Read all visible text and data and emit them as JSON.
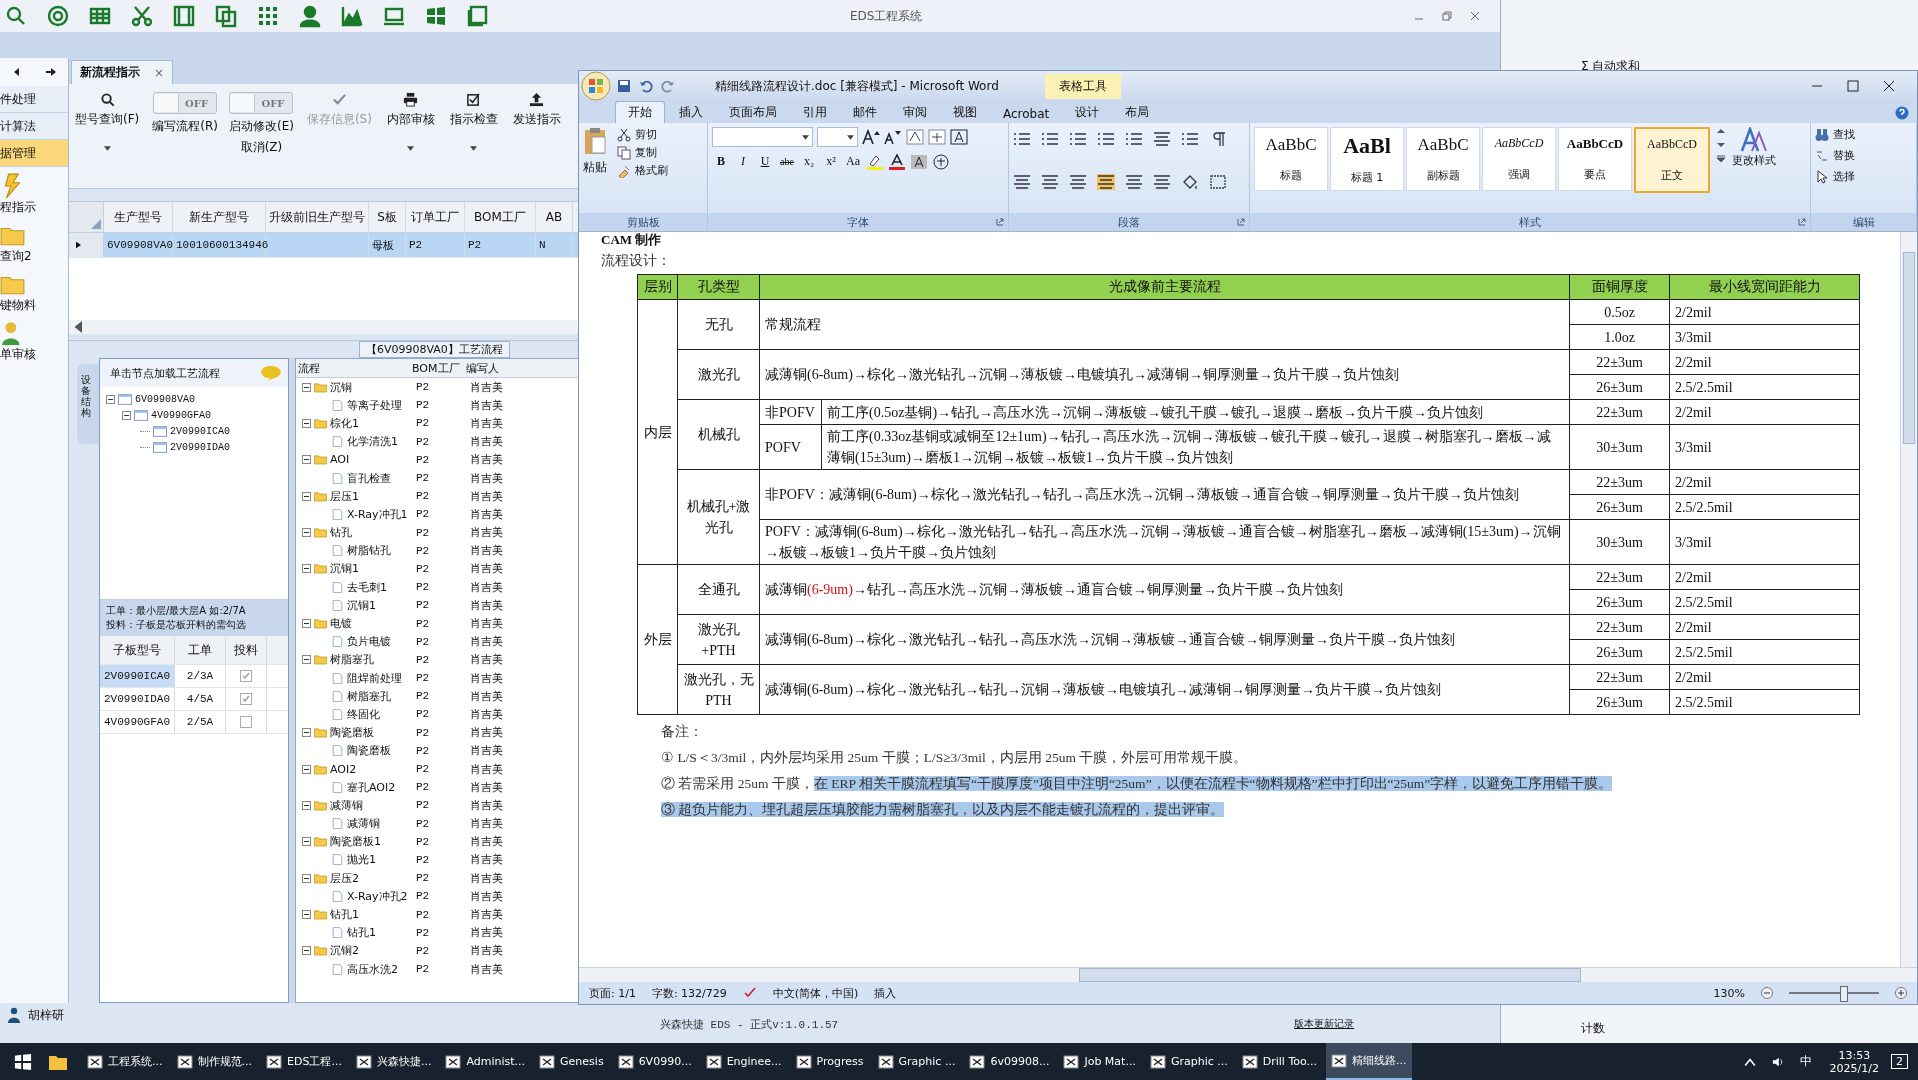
{
  "eds": {
    "title": "EDS工程系统",
    "nav": [
      {
        "label": "件处理",
        "selected": false
      },
      {
        "label": "计算法",
        "selected": false
      },
      {
        "label": "据管理",
        "selected": true
      }
    ],
    "nav_tools": [
      {
        "label": "程指示"
      },
      {
        "label": "查询2"
      },
      {
        "label": "键物料"
      },
      {
        "label": "单审核"
      }
    ],
    "tab": {
      "label": "新流程指示",
      "close": "×"
    },
    "toolbar": [
      {
        "kind": "button",
        "label": "型号查询(F)",
        "dropdown": true,
        "disabled": false
      },
      {
        "kind": "toggle",
        "label": "编写流程(R)",
        "state_label": "OFF",
        "on": false
      },
      {
        "kind": "toggle",
        "label": "启动修改(E)",
        "label2": "取消(Z)",
        "state_label": "OFF",
        "on": false
      },
      {
        "kind": "button",
        "label": "保存信息(S)",
        "dropdown": false,
        "disabled": true
      },
      {
        "kind": "button",
        "label": "内部审核",
        "dropdown": true,
        "disabled": false
      },
      {
        "kind": "button",
        "label": "指示检查",
        "dropdown": true,
        "disabled": false
      },
      {
        "kind": "button",
        "label": "发送指示",
        "dropdown": false,
        "disabled": false
      }
    ],
    "grid": {
      "columns": [
        "生产型号",
        "新生产型号",
        "升级前旧生产型号",
        "S板",
        "订单工厂",
        "BOM工厂",
        "AB"
      ],
      "rows": [
        {
          "selected": true,
          "cells": [
            "6V09908VA0",
            "10010600134946",
            null,
            "母板",
            "P2",
            "P2",
            "N"
          ]
        }
      ]
    },
    "process_title": "【6V09908VA0】工艺流程",
    "side_tab": "设备结构",
    "tree_hint": "单击节点加载工艺流程",
    "tree": [
      {
        "label": "6V09908VA0",
        "expanded": true,
        "children": [
          {
            "label": "4V0990GFA0",
            "expanded": true,
            "children": [
              {
                "label": "2V0990ICA0"
              },
              {
                "label": "2V0990IDA0"
              }
            ]
          }
        ]
      }
    ],
    "notes": [
      "工单：最小层/最大层A 如:2/7A",
      "投料：子板是芯板开料的需勾选"
    ],
    "sub_table": {
      "columns": [
        "子板型号",
        "工单",
        "投料"
      ],
      "rows": [
        {
          "model": "2V0990ICA0",
          "order": "2/3A",
          "feed": true,
          "selected": true
        },
        {
          "model": "2V0990IDA0",
          "order": "4/5A",
          "feed": true,
          "selected": false
        },
        {
          "model": "4V0990GFA0",
          "order": "2/5A",
          "feed": false,
          "selected": false
        }
      ]
    },
    "flow": {
      "columns": [
        "流程",
        "BOM工厂",
        "编写人"
      ],
      "groups": [
        {
          "name": "沉铜",
          "bom": "P2",
          "author": "肖吉美",
          "expanded": true,
          "children": [
            {
              "name": "等离子处理",
              "bom": "P2",
              "author": "肖吉美"
            }
          ]
        },
        {
          "name": "棕化1",
          "bom": "P2",
          "author": "肖吉美",
          "expanded": true,
          "children": [
            {
              "name": "化学清洗1",
              "bom": "P2",
              "author": "肖吉美"
            }
          ]
        },
        {
          "name": "AOI",
          "bom": "P2",
          "author": "肖吉美",
          "expanded": true,
          "children": [
            {
              "name": "盲孔检查",
              "bom": "P2",
              "author": "肖吉美"
            }
          ]
        },
        {
          "name": "层压1",
          "bom": "P2",
          "author": "肖吉美",
          "expanded": true,
          "children": [
            {
              "name": "X-Ray冲孔1",
              "bom": "P2",
              "author": "肖吉美"
            }
          ]
        },
        {
          "name": "钻孔",
          "bom": "P2",
          "author": "肖吉美",
          "expanded": true,
          "children": [
            {
              "name": "树脂钻孔",
              "bom": "P2",
              "author": "肖吉美"
            }
          ]
        },
        {
          "name": "沉铜1",
          "bom": "P2",
          "author": "肖吉美",
          "expanded": true,
          "children": [
            {
              "name": "去毛刺1",
              "bom": "P2",
              "author": "肖吉美"
            },
            {
              "name": "沉铜1",
              "bom": "P2",
              "author": "肖吉美"
            }
          ]
        },
        {
          "name": "电镀",
          "bom": "P2",
          "author": "肖吉美",
          "expanded": true,
          "children": [
            {
              "name": "负片电镀",
              "bom": "P2",
              "author": "肖吉美"
            }
          ]
        },
        {
          "name": "树脂塞孔",
          "bom": "P2",
          "author": "肖吉美",
          "expanded": true,
          "children": [
            {
              "name": "阻焊前处理",
              "bom": "P2",
              "author": "肖吉美"
            },
            {
              "name": "树脂塞孔",
              "bom": "P2",
              "author": "肖吉美"
            },
            {
              "name": "终固化",
              "bom": "P2",
              "author": "肖吉美"
            }
          ]
        },
        {
          "name": "陶瓷磨板",
          "bom": "P2",
          "author": "肖吉美",
          "expanded": true,
          "children": [
            {
              "name": "陶瓷磨板",
              "bom": "P2",
              "author": "肖吉美"
            }
          ]
        },
        {
          "name": "AOI2",
          "bom": "P2",
          "author": "肖吉美",
          "expanded": true,
          "children": [
            {
              "name": "塞孔AOI2",
              "bom": "P2",
              "author": "肖吉美"
            }
          ]
        },
        {
          "name": "减薄铜",
          "bom": "P2",
          "author": "肖吉美",
          "expanded": true,
          "children": [
            {
              "name": "减薄铜",
              "bom": "P2",
              "author": "肖吉美"
            }
          ]
        },
        {
          "name": "陶瓷磨板1",
          "bom": "P2",
          "author": "肖吉美",
          "expanded": true,
          "children": [
            {
              "name": "抛光1",
              "bom": "P2",
              "author": "肖吉美"
            }
          ]
        },
        {
          "name": "层压2",
          "bom": "P2",
          "author": "肖吉美",
          "expanded": true,
          "children": [
            {
              "name": "X-Ray冲孔2",
              "bom": "P2",
              "author": "肖吉美"
            }
          ]
        },
        {
          "name": "钻孔1",
          "bom": "P2",
          "author": "肖吉美",
          "expanded": true,
          "children": [
            {
              "name": "钻孔1",
              "bom": "P2",
              "author": "肖吉美"
            }
          ]
        },
        {
          "name": "沉铜2",
          "bom": "P2",
          "author": "肖吉美",
          "expanded": true,
          "children": [
            {
              "name": "高压水洗2",
              "bom": "P2",
              "author": "肖吉美"
            }
          ]
        }
      ]
    },
    "user": "胡梓研",
    "version": "兴森快捷 EDS - 正式v:1.0.1.57",
    "update_link": "版本更新记录"
  },
  "word": {
    "title": "精细线路流程设计.doc [兼容模式] - Microsoft Word",
    "context_tab": "表格工具",
    "tabs": [
      {
        "label": "开始",
        "selected": true
      },
      {
        "label": "插入",
        "selected": false
      },
      {
        "label": "页面布局",
        "selected": false
      },
      {
        "label": "引用",
        "selected": false
      },
      {
        "label": "邮件",
        "selected": false
      },
      {
        "label": "审阅",
        "selected": false
      },
      {
        "label": "视图",
        "selected": false
      },
      {
        "label": "Acrobat",
        "selected": false
      },
      {
        "label": "设计",
        "selected": false
      },
      {
        "label": "布局",
        "selected": false
      }
    ],
    "clipboard": {
      "paste": "粘贴",
      "items": [
        "剪切",
        "复制",
        "格式刷"
      ],
      "group": "剪贴板"
    },
    "font": {
      "buttons": [
        "B",
        "I",
        "U",
        "abe",
        "x₂",
        "x²",
        "Aa"
      ],
      "group": "字体"
    },
    "paragraph": {
      "group": "段落"
    },
    "styles": {
      "items": [
        {
          "preview": "AaBbC",
          "name": "标题",
          "selected": false
        },
        {
          "preview": "AaBl",
          "name": "标题 1",
          "selected": false
        },
        {
          "preview": "AaBbC",
          "name": "副标题",
          "selected": false
        },
        {
          "preview": "AaBbCcD",
          "name": "强调",
          "selected": false
        },
        {
          "preview": "AaBbCcD",
          "name": "要点",
          "selected": false
        },
        {
          "preview": "AaBbCcD",
          "name": "正文",
          "selected": true
        }
      ],
      "change": "更改样式",
      "group": "样式"
    },
    "editing": {
      "items": [
        "查找",
        "替换",
        "选择"
      ],
      "group": "编辑"
    },
    "heading": "CAM 制作",
    "intro": "流程设计：",
    "table": {
      "columns": [
        "层别",
        "孔类型",
        "光成像前主要流程",
        "面铜厚度",
        "最小线宽间距能力"
      ],
      "sections": [
        {
          "layer": "内层",
          "types": [
            {
              "name": "无孔",
              "flows": [
                {
                  "text": "常规流程",
                  "specs": [
                    {
                      "thickness": "0.5oz",
                      "ls": "2/2mil"
                    },
                    {
                      "thickness": "1.0oz",
                      "ls": "3/3mil"
                    }
                  ]
                }
              ]
            },
            {
              "name": "激光孔",
              "flows": [
                {
                  "text": "减薄铜(6-8um)→棕化→激光钻孔→沉铜→薄板镀→电镀填孔→减薄铜→铜厚测量→负片干膜→负片蚀刻",
                  "specs": [
                    {
                      "thickness": "22±3um",
                      "ls": "2/2mil"
                    },
                    {
                      "thickness": "26±3um",
                      "ls": "2.5/2.5mil"
                    }
                  ]
                }
              ]
            },
            {
              "name": "机械孔",
              "flows": [
                {
                  "sub": "非POFV",
                  "text": "前工序(0.5oz基铜)→钻孔→高压水洗→沉铜→薄板镀→镀孔干膜→镀孔→退膜→磨板→负片干膜→负片蚀刻",
                  "specs": [
                    {
                      "thickness": "22±3um",
                      "ls": "2/2mil"
                    }
                  ]
                },
                {
                  "sub": "POFV",
                  "text": "前工序(0.33oz基铜或减铜至12±1um)→钻孔→高压水洗→沉铜→薄板镀→镀孔干膜→镀孔→退膜→树脂塞孔→磨板→减薄铜(15±3um)→磨板1→沉铜→板镀→板镀1→负片干膜→负片蚀刻",
                  "specs": [
                    {
                      "thickness": "30±3um",
                      "ls": "3/3mil"
                    }
                  ]
                }
              ]
            },
            {
              "name": "机械孔+激光孔",
              "flows": [
                {
                  "text": "非POFV：减薄铜(6-8um)→棕化→激光钻孔→钻孔→高压水洗→沉铜→薄板镀→通盲合镀→铜厚测量→负片干膜→负片蚀刻",
                  "specs": [
                    {
                      "thickness": "22±3um",
                      "ls": "2/2mil"
                    },
                    {
                      "thickness": "26±3um",
                      "ls": "2.5/2.5mil"
                    }
                  ]
                },
                {
                  "text": "POFV：减薄铜(6-8um)→棕化→激光钻孔→钻孔→高压水洗→沉铜→薄板镀→通盲合镀→树脂塞孔→磨板→减薄铜(15±3um)→沉铜→板镀→板镀1→负片干膜→负片蚀刻",
                  "specs": [
                    {
                      "thickness": "30±3um",
                      "ls": "3/3mil"
                    }
                  ]
                }
              ]
            }
          ]
        },
        {
          "layer": "外层",
          "types": [
            {
              "name": "全通孔",
              "flows": [
                {
                  "parts": [
                    {
                      "text": "减薄铜",
                      "red": false
                    },
                    {
                      "text": "(6-9um)",
                      "red": true
                    },
                    {
                      "text": "→钻孔→高压水洗→沉铜→薄板镀→通盲合镀→铜厚测量→负片干膜→负片蚀刻",
                      "red": false
                    }
                  ],
                  "specs": [
                    {
                      "thickness": "22±3um",
                      "ls": "2/2mil"
                    },
                    {
                      "thickness": "26±3um",
                      "ls": "2.5/2.5mil"
                    }
                  ]
                }
              ]
            },
            {
              "name": "激光孔+PTH",
              "flows": [
                {
                  "text": "减薄铜(6-8um)→棕化→激光钻孔→钻孔→高压水洗→沉铜→薄板镀→通盲合镀→铜厚测量→负片干膜→负片蚀刻",
                  "specs": [
                    {
                      "thickness": "22±3um",
                      "ls": "2/2mil"
                    },
                    {
                      "thickness": "26±3um",
                      "ls": "2.5/2.5mil"
                    }
                  ]
                }
              ]
            },
            {
              "name": "激光孔，无PTH",
              "flows": [
                {
                  "text": "减薄铜(6-8um)→棕化→激光钻孔→钻孔→沉铜→薄板镀→电镀填孔→减薄铜→铜厚测量→负片干膜→负片蚀刻",
                  "specs": [
                    {
                      "thickness": "22±3um",
                      "ls": "2/2mil"
                    },
                    {
                      "thickness": "26±3um",
                      "ls": "2.5/2.5mil"
                    }
                  ]
                }
              ]
            }
          ]
        }
      ]
    },
    "notes_title": "备注：",
    "notes": [
      {
        "parts": [
          {
            "text": "① L/S＜3/3mil，内外层均采用 25um 干膜；L/S≥3/3mil，内层用 25um 干膜，外层可用常规干膜。",
            "selected": false
          }
        ]
      },
      {
        "parts": [
          {
            "text": "② 若需采用 25um 干膜，",
            "selected": false
          },
          {
            "text": "在 ERP 相关干膜流程填写“干膜厚度”项目中注明“25um”，以便在流程卡“物料规格”栏中打印出“25um”字样，以避免工序用错干膜。",
            "selected": true
          }
        ]
      },
      {
        "parts": [
          {
            "text": "③ 超负片能力、埋孔超层压填胶能力需树脂塞孔，以及内层不能走镀孔流程的，提出评审。",
            "selected": true
          }
        ]
      }
    ],
    "status": {
      "page": "页面: 1/1",
      "words": "字数: 132/729",
      "language": "中文(简体，中国)",
      "mode": "插入",
      "zoom": "130%",
      "level": 0.6
    }
  },
  "background": {
    "autosum": "Σ 自动求和",
    "count": "计数"
  },
  "taskbar": {
    "apps": [
      {
        "label": "工程系统...",
        "active": false
      },
      {
        "label": "制作规范...",
        "active": false
      },
      {
        "label": "EDS工程...",
        "active": false
      },
      {
        "label": "兴森快捷...",
        "active": false
      },
      {
        "label": "Administ...",
        "active": false
      },
      {
        "label": "Genesis",
        "active": false
      },
      {
        "label": "6V0990...",
        "active": false
      },
      {
        "label": "Enginee...",
        "active": false
      },
      {
        "label": "Progress",
        "active": false
      },
      {
        "label": "Graphic ...",
        "active": false
      },
      {
        "label": "6v09908...",
        "active": false
      },
      {
        "label": "Job Mat...",
        "active": false
      },
      {
        "label": "Graphic ...",
        "active": false
      },
      {
        "label": "Drill Too...",
        "active": false
      },
      {
        "label": "精细线路...",
        "active": true
      }
    ],
    "ime": "中",
    "time": "13:53",
    "date": "2025/1/2",
    "notifications": "2"
  }
}
